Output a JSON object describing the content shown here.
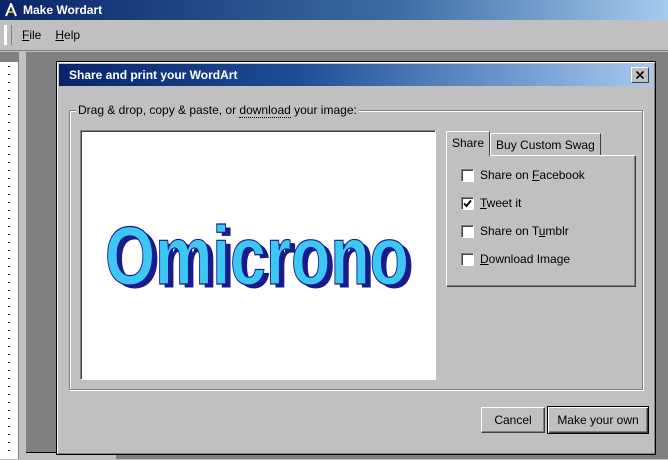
{
  "app": {
    "title": "Make Wordart"
  },
  "menu": [
    {
      "key": "F",
      "rest": "ile"
    },
    {
      "key": "H",
      "rest": "elp"
    }
  ],
  "dialog": {
    "title": "Share and print your WordArt",
    "group_label_pre": "Drag & drop, copy & paste, or ",
    "group_label_link": "download",
    "group_label_post": " your image:",
    "wordart_text": "Omicrono",
    "tabs": [
      {
        "label": "Share",
        "active": true
      },
      {
        "label": "Buy Custom Swag",
        "active": false
      }
    ],
    "options": [
      {
        "pre": "Share on ",
        "key": "F",
        "post": "acebook",
        "checked": false
      },
      {
        "pre": "",
        "key": "T",
        "post": "weet it",
        "checked": true
      },
      {
        "pre": "Share on T",
        "key": "u",
        "post": "mblr",
        "checked": false
      },
      {
        "pre": "",
        "key": "D",
        "post": "ownload Image",
        "checked": false
      }
    ],
    "cancel_label": "Cancel",
    "make_own_label": "Make your own"
  },
  "colors": {
    "wordart_face": "#3cc8f5",
    "wordart_shadow": "#1a1a8c"
  }
}
